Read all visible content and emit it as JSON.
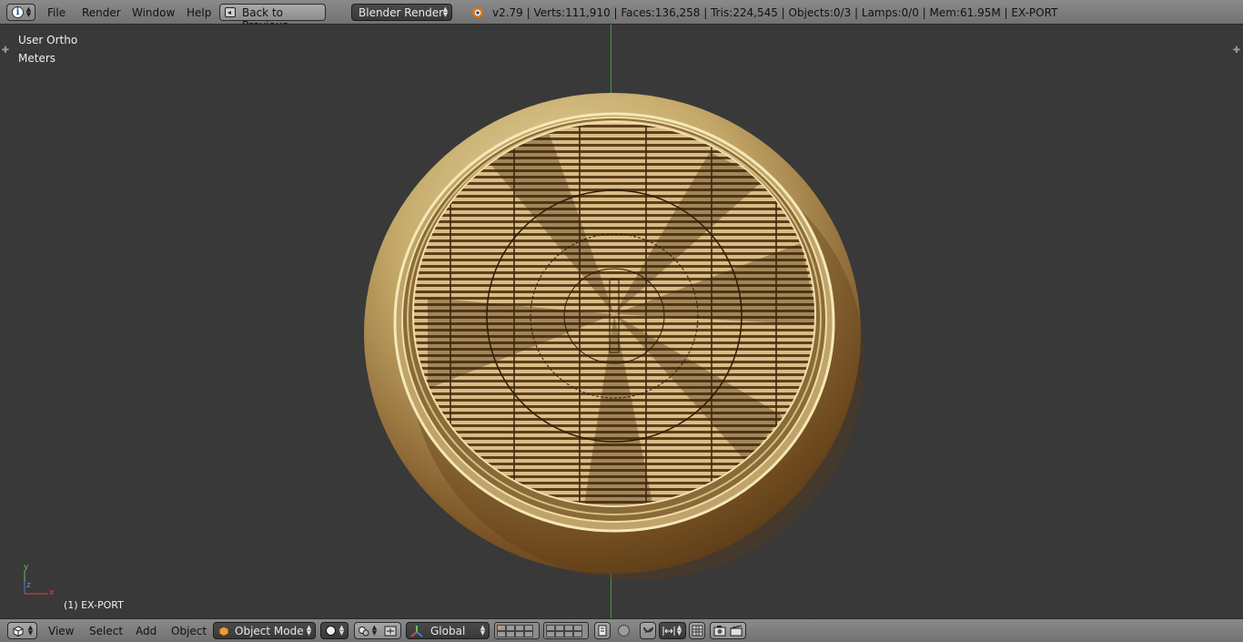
{
  "top_header": {
    "menus": [
      "File",
      "Render",
      "Window",
      "Help"
    ],
    "back_button": "Back to Previous",
    "render_engine": "Blender Render",
    "stats": "v2.79 | Verts:111,910 | Faces:136,258 | Tris:224,545 | Objects:0/3 | Lamps:0/0 | Mem:61.95M | EX-PORT"
  },
  "viewport": {
    "view_name": "User Ortho",
    "units": "Meters",
    "active_object": "(1) EX-PORT",
    "axis_labels": {
      "y": "y",
      "z": "z",
      "x": "x"
    }
  },
  "bottom_header": {
    "menus": [
      "View",
      "Select",
      "Add",
      "Object"
    ],
    "mode": "Object Mode",
    "orientation": "Global"
  },
  "colors": {
    "header_bg": "#7d7d7d",
    "viewport_bg": "#393939",
    "y_axis_line": "#3f9d3f",
    "coin_gold": "#b89a5e"
  }
}
